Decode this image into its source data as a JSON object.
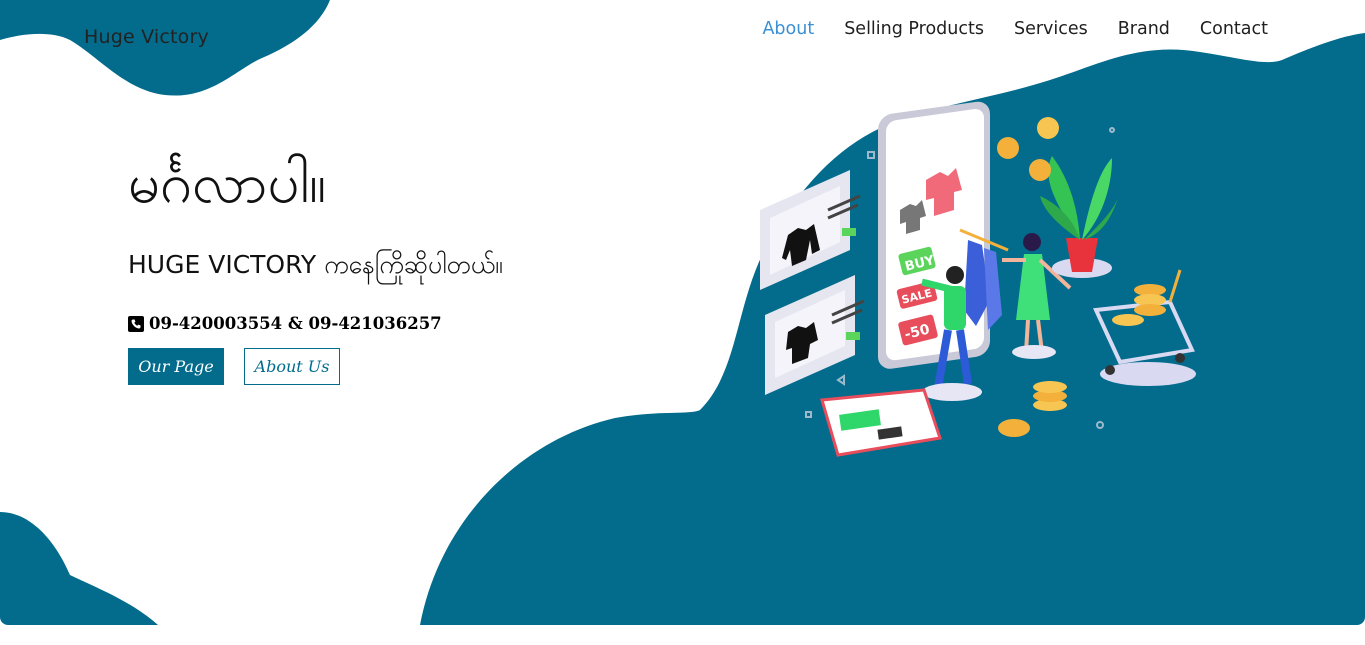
{
  "brand": {
    "name": "Huge Victory"
  },
  "nav": {
    "items": [
      {
        "label": "About",
        "active": true
      },
      {
        "label": "Selling Products",
        "active": false
      },
      {
        "label": "Services",
        "active": false
      },
      {
        "label": "Brand",
        "active": false
      },
      {
        "label": "Contact",
        "active": false
      }
    ]
  },
  "hero": {
    "title": "မင်္ဂလာပါ။",
    "subtitle": "HUGE VICTORY ကနေကြိုဆိုပါတယ်။",
    "phone": "09-420003554 & 09-421036257",
    "phone_icon": "phone-icon",
    "primary_button": "Our Page",
    "secondary_button": "About Us"
  },
  "illustration": {
    "buy_label": "BUY",
    "sale_label": "SALE",
    "discount_label": "-50"
  },
  "colors": {
    "accent": "#036c8c",
    "nav_active": "#3b8fd4",
    "text": "#111111"
  }
}
